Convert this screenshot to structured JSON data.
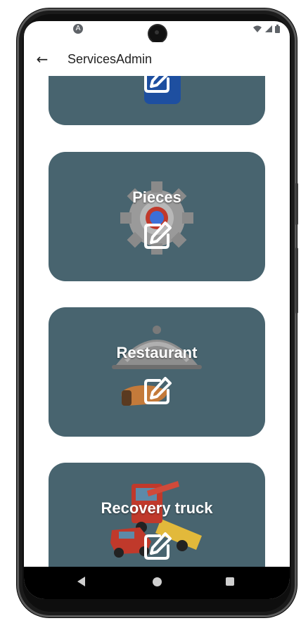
{
  "app": {
    "title": "ServicesAdmin"
  },
  "status_bar": {
    "left_icon": "a-icon",
    "right_icons": [
      "wifi-icon",
      "signal-icon",
      "battery-icon"
    ],
    "left_glyph": "A"
  },
  "app_bar": {
    "back_icon": "arrow-left-icon",
    "back_glyph": "←"
  },
  "services": [
    {
      "name": "",
      "image": "blue-box-icon",
      "action_icon": "edit-icon"
    },
    {
      "name": "Pieces",
      "image": "gear-icon",
      "action_icon": "edit-icon"
    },
    {
      "name": "Restaurant",
      "image": "cloche-icon",
      "action_icon": "edit-icon"
    },
    {
      "name": "Recovery truck",
      "image": "tow-truck-icon",
      "action_icon": "edit-icon"
    }
  ],
  "navigation_bar": {
    "items": [
      "back-icon",
      "home-icon",
      "recents-icon"
    ]
  },
  "colors": {
    "card": "#48646f",
    "text": "#ffffff",
    "appbar_text": "#222222",
    "navbar": "#000000"
  }
}
